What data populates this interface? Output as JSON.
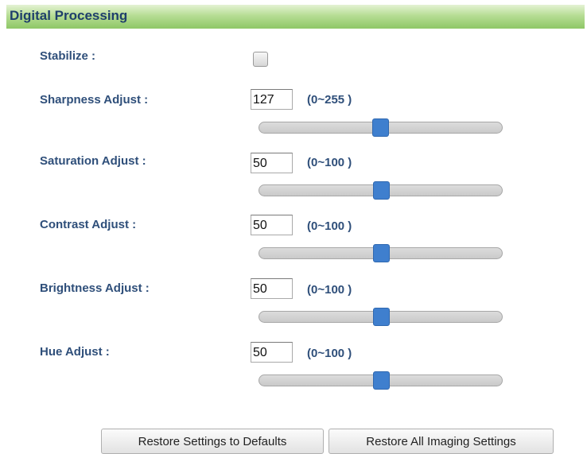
{
  "section": {
    "title": "Digital Processing"
  },
  "stabilize": {
    "label": "Stabilize :",
    "checked": false
  },
  "settings": [
    {
      "label": "Sharpness Adjust :",
      "value": "127",
      "range": "(0~255 )",
      "level": 0.498
    },
    {
      "label": "Saturation Adjust :",
      "value": "50",
      "range": "(0~100 )",
      "level": 0.5
    },
    {
      "label": "Contrast Adjust :",
      "value": "50",
      "range": "(0~100 )",
      "level": 0.5
    },
    {
      "label": "Brightness Adjust :",
      "value": "50",
      "range": "(0~100 )",
      "level": 0.5
    },
    {
      "label": "Hue Adjust :",
      "value": "50",
      "range": "(0~100 )",
      "level": 0.5
    }
  ],
  "buttons": {
    "restore_defaults": "Restore Settings to Defaults",
    "restore_all": "Restore All Imaging Settings"
  },
  "colors": {
    "header_green": "#8ec766",
    "label_blue": "#2f4f7a",
    "slider_handle": "#3f7fce"
  }
}
